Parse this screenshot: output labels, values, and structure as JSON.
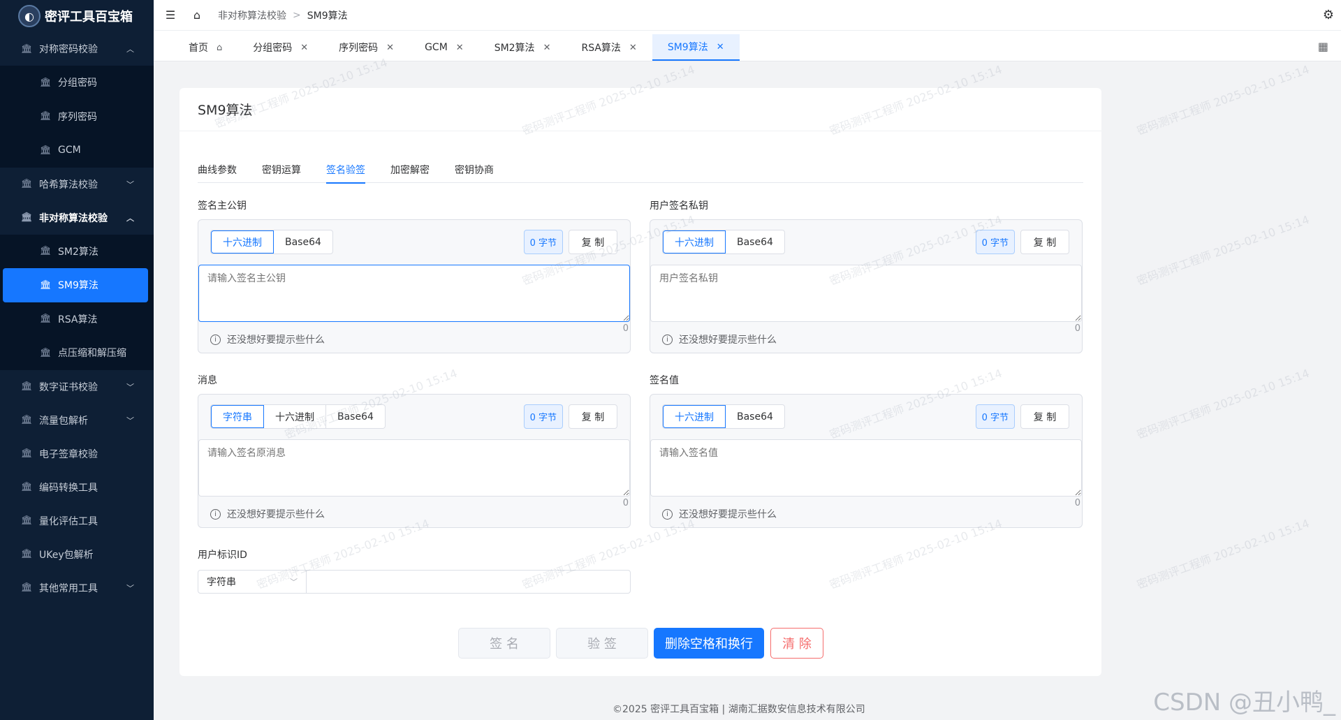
{
  "app": {
    "title": "密评工具百宝箱"
  },
  "sidebar": {
    "groups": [
      {
        "label": "对称密码校验",
        "expanded": true,
        "items": [
          "分组密码",
          "序列密码",
          "GCM"
        ]
      },
      {
        "label": "哈希算法校验",
        "expanded": false
      },
      {
        "label": "非对称算法校验",
        "expanded": true,
        "items": [
          "SM2算法",
          "SM9算法",
          "RSA算法",
          "点压缩和解压缩"
        ]
      },
      {
        "label": "数字证书校验",
        "expanded": false
      },
      {
        "label": "流量包解析",
        "expanded": false
      },
      {
        "label": "电子签章校验"
      },
      {
        "label": "编码转换工具"
      },
      {
        "label": "量化评估工具"
      },
      {
        "label": "UKey包解析"
      },
      {
        "label": "其他常用工具",
        "expanded": false
      }
    ],
    "active_item": "SM9算法"
  },
  "breadcrumb": {
    "parent": "非对称算法校验",
    "current": "SM9算法"
  },
  "tabs": [
    "首页",
    "分组密码",
    "序列密码",
    "GCM",
    "SM2算法",
    "RSA算法",
    "SM9算法"
  ],
  "active_tab": "SM9算法",
  "page": {
    "title": "SM9算法",
    "subtabs": [
      "曲线参数",
      "密钥运算",
      "签名验签",
      "加密解密",
      "密钥协商"
    ],
    "active_subtab": "签名验签"
  },
  "panels": {
    "master_pub": {
      "label": "签名主公钥",
      "formats": [
        "十六进制",
        "Base64"
      ],
      "bytes": "0 字节",
      "copy": "复 制",
      "placeholder": "请输入签名主公钥",
      "count": "0",
      "hint": "还没想好要提示些什么"
    },
    "user_priv": {
      "label": "用户签名私钥",
      "formats": [
        "十六进制",
        "Base64"
      ],
      "bytes": "0 字节",
      "copy": "复 制",
      "placeholder": "用户签名私钥",
      "count": "0",
      "hint": "还没想好要提示些什么"
    },
    "message": {
      "label": "消息",
      "formats": [
        "字符串",
        "十六进制",
        "Base64"
      ],
      "bytes": "0 字节",
      "copy": "复 制",
      "placeholder": "请输入签名原消息",
      "count": "0",
      "hint": "还没想好要提示些什么"
    },
    "signature": {
      "label": "签名值",
      "formats": [
        "十六进制",
        "Base64"
      ],
      "bytes": "0 字节",
      "copy": "复 制",
      "placeholder": "请输入签名值",
      "count": "0",
      "hint": "还没想好要提示些什么"
    }
  },
  "user_id": {
    "label": "用户标识ID",
    "type": "字符串",
    "value": ""
  },
  "buttons": {
    "sign": "签 名",
    "verify": "验 签",
    "strip": "删除空格和换行",
    "clear": "清 除"
  },
  "footer": "©2025 密评工具百宝箱 | 湖南汇据数安信息技术有限公司",
  "watermark": "密码测评工程师 2025-02-10 15:14",
  "csdn": "CSDN @丑小鸭_",
  "colors": {
    "accent": "#1677ff",
    "sidebar": "#0e1f35",
    "danger": "#f56c6c"
  }
}
